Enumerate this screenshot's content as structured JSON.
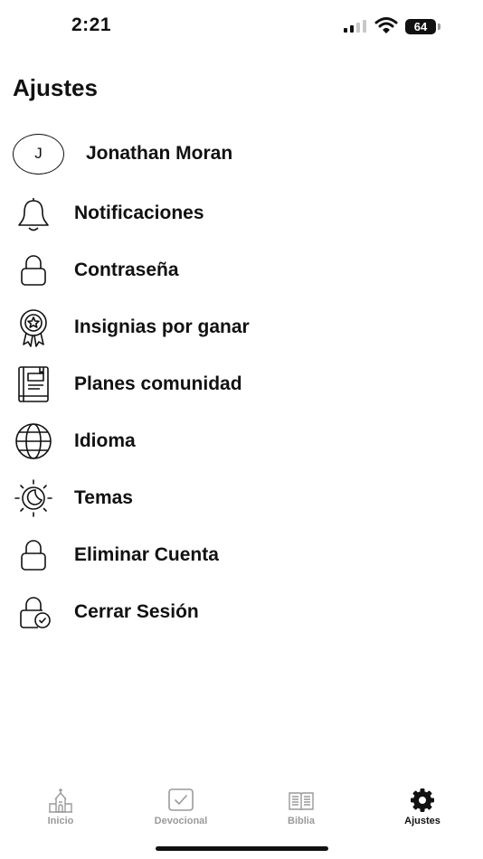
{
  "status_bar": {
    "time": "2:21",
    "battery": "64"
  },
  "header": {
    "title": "Ajustes"
  },
  "profile": {
    "initial": "J",
    "name": "Jonathan Moran"
  },
  "menu": {
    "items": [
      {
        "label": "Notificaciones",
        "icon": "bell-icon"
      },
      {
        "label": "Contraseña",
        "icon": "lock-icon"
      },
      {
        "label": "Insignias por ganar",
        "icon": "badge-icon"
      },
      {
        "label": "Planes comunidad",
        "icon": "book-icon"
      },
      {
        "label": "Idioma",
        "icon": "globe-icon"
      },
      {
        "label": "Temas",
        "icon": "theme-icon"
      },
      {
        "label": "Eliminar Cuenta",
        "icon": "lock-icon"
      },
      {
        "label": "Cerrar Sesión",
        "icon": "logout-icon"
      }
    ]
  },
  "tab_bar": {
    "tabs": [
      {
        "label": "Inicio",
        "icon": "church-icon",
        "active": false
      },
      {
        "label": "Devocional",
        "icon": "check-square-icon",
        "active": false
      },
      {
        "label": "Biblia",
        "icon": "open-book-icon",
        "active": false
      },
      {
        "label": "Ajustes",
        "icon": "gear-icon",
        "active": true
      }
    ]
  },
  "colors": {
    "active": "#111111",
    "inactive": "#9a9a9a",
    "background": "#ffffff"
  }
}
